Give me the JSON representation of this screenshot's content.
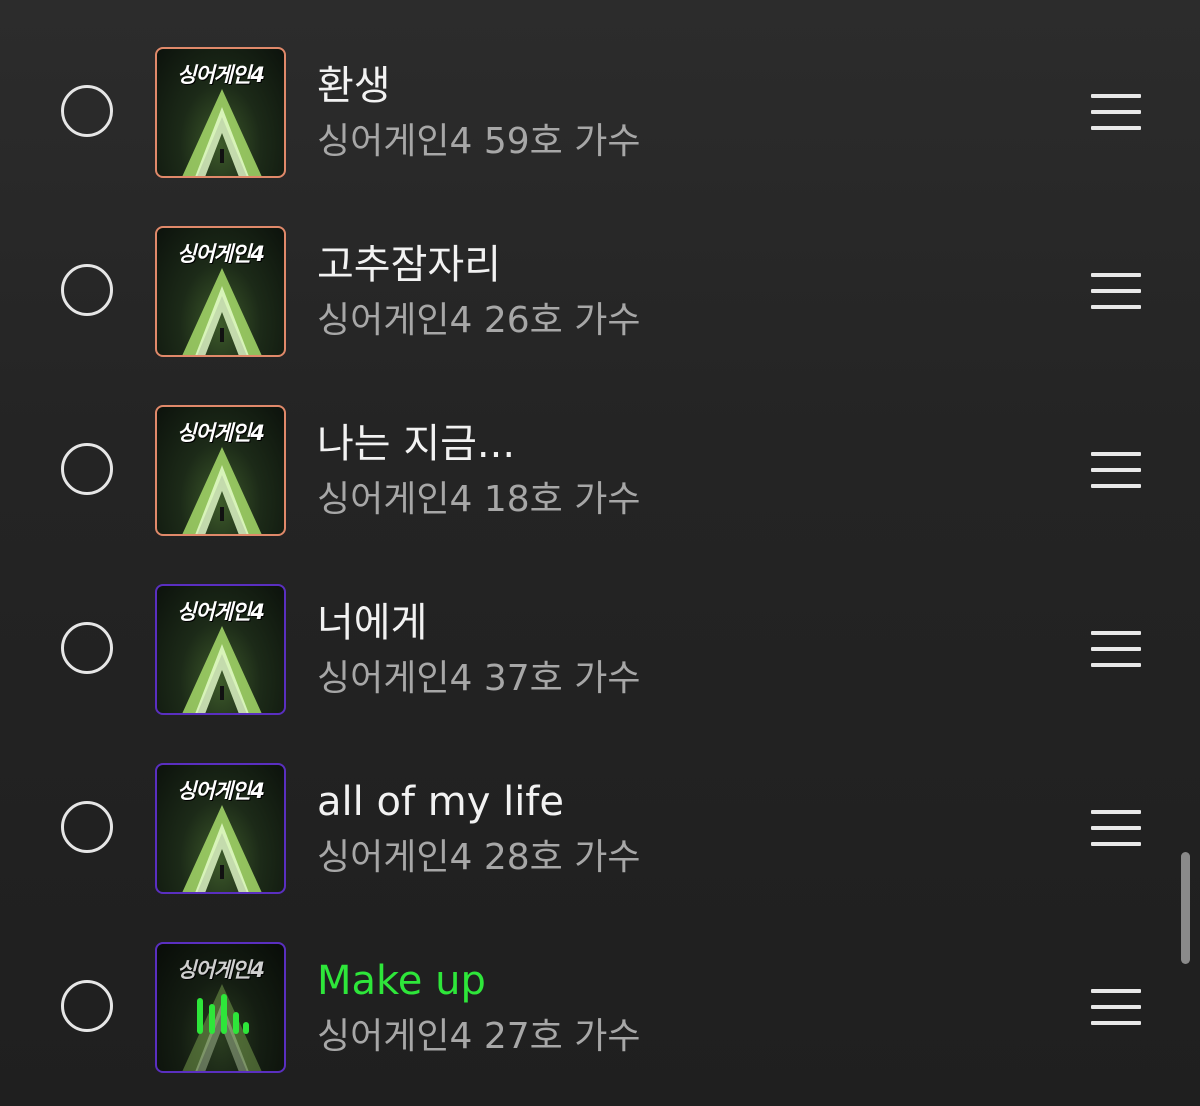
{
  "queue": {
    "items": [
      {
        "title": "환생",
        "artist": "싱어게인4 59호 가수",
        "cover_text": "싱어게인4",
        "cover_border": "#e0896a",
        "playing": false
      },
      {
        "title": "고추잠자리",
        "artist": "싱어게인4 26호 가수",
        "cover_text": "싱어게인4",
        "cover_border": "#e0896a",
        "playing": false
      },
      {
        "title": "나는 지금...",
        "artist": "싱어게인4 18호 가수",
        "cover_text": "싱어게인4",
        "cover_border": "#e0896a",
        "playing": false
      },
      {
        "title": "너에게",
        "artist": "싱어게인4 37호 가수",
        "cover_text": "싱어게인4",
        "cover_border": "#5a2fc0",
        "playing": false
      },
      {
        "title": "all of my life",
        "artist": "싱어게인4 28호 가수",
        "cover_text": "싱어게인4",
        "cover_border": "#5a2fc0",
        "playing": false
      },
      {
        "title": "Make up",
        "artist": "싱어게인4 27호 가수",
        "cover_text": "싱어게인4",
        "cover_border": "#5a2fc0",
        "playing": true
      }
    ]
  },
  "colors": {
    "background": "#242424",
    "title_text": "#f2f2f2",
    "artist_text": "#a7a7a7",
    "now_playing": "#2ee63a"
  },
  "icons": {
    "select": "circle-outline-icon",
    "reorder": "drag-handle-icon",
    "now_playing": "equalizer-icon"
  }
}
